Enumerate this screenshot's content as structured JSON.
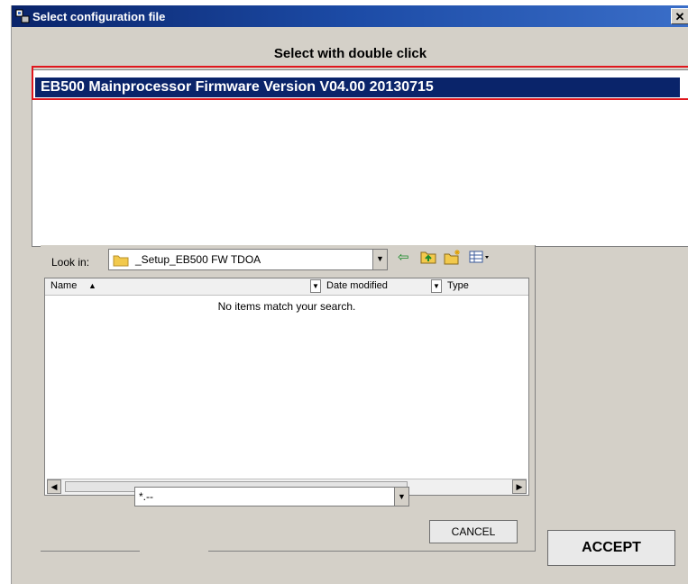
{
  "window": {
    "title": "Select configuration file",
    "close_glyph": "✕"
  },
  "heading": "Select with double click",
  "config_list": {
    "items": [
      "EB500 Mainprocessor Firmware Version V04.00 20130715"
    ],
    "selected_index": 0
  },
  "file_dialog": {
    "look_in_label": "Look in:",
    "look_in_value": "_Setup_EB500 FW TDOA",
    "columns": [
      "Name",
      "Date modified",
      "Type"
    ],
    "empty_message": "No items match your search.",
    "filter_value": "*.--",
    "cancel_label": "CANCEL"
  },
  "accept_label": "ACCEPT",
  "colors": {
    "selection": "#0a246a",
    "highlight_border": "#e0161d",
    "title_bar": "#0a246a"
  },
  "icons": [
    "app-icon",
    "close-icon",
    "folder-icon",
    "back-arrow-icon",
    "up-folder-icon",
    "new-folder-icon",
    "view-menu-icon",
    "dropdown-arrow-icon",
    "scroll-left-icon",
    "scroll-right-icon",
    "sort-ascending-icon"
  ]
}
